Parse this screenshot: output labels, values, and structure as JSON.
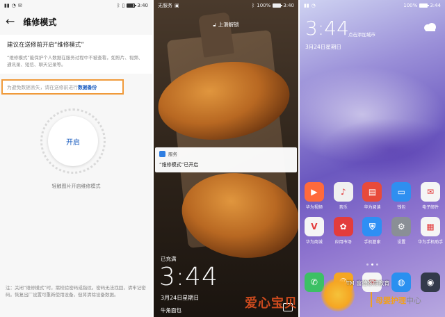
{
  "panel_settings": {
    "status": {
      "time": "3:40"
    },
    "title": "维修模式",
    "heading": "建议在送修前开启“维修模式”",
    "description": "“维修模式”能保护个人数据在服务过程中不被查看，如照片、视频、通讯录、短信、聊天记录等。",
    "warning_text": "为避免数据丢失，请在送修前进行",
    "warning_link": "数据备份",
    "enable_button": "开启",
    "hint": "轻触图片开启维修模式",
    "footer": "注：关闭“维修模式”时，需校验密码或指纹。密码无法找回，请牢记密码。恢复出厂设置可重新使用设备，但将清除设备数据。"
  },
  "panel_lock": {
    "status": {
      "carrier": "无服务",
      "battery": "100%",
      "time": "3:40"
    },
    "swipe_text": "上滑解锁",
    "notification": {
      "app": "服务",
      "body": "“维修模式”已开启"
    },
    "charged": "已充满",
    "time": "3:44",
    "date": "3月24日星期日",
    "caption": "牛角面包"
  },
  "panel_home": {
    "status": {
      "battery": "100%",
      "time": "3:44"
    },
    "time": "3:44",
    "city_hint": "点击添加城市",
    "date": "3月24日星期日",
    "rows": [
      [
        {
          "label": "华为视频",
          "color": "#ff6a3c",
          "glyph": "▶"
        },
        {
          "label": "音乐",
          "color": "#f0f0f0",
          "glyph": "♪"
        },
        {
          "label": "华为阅读",
          "color": "#e84a3a",
          "glyph": "▤"
        },
        {
          "label": "钱包",
          "color": "#2f8ff0",
          "glyph": "▭"
        },
        {
          "label": "电子邮件",
          "color": "#f5f5f5",
          "glyph": "✉"
        }
      ],
      [
        {
          "label": "华为商城",
          "color": "#f5f5f5",
          "glyph": "V"
        },
        {
          "label": "应用市场",
          "color": "#e33c3c",
          "glyph": "✿"
        },
        {
          "label": "手机管家",
          "color": "#2e8ff4",
          "glyph": "⛨"
        },
        {
          "label": "设置",
          "color": "#8a8f96",
          "glyph": "⚙"
        },
        {
          "label": "华为手机助手",
          "color": "#f5f5f5",
          "glyph": "▦"
        }
      ]
    ],
    "dock": [
      {
        "label": "电话",
        "color": "#3cc065",
        "glyph": "✆"
      },
      {
        "label": "联系人",
        "color": "#f5a623",
        "glyph": "☺"
      },
      {
        "label": "信息",
        "color": "#f5f5f5",
        "glyph": "✉"
      },
      {
        "label": "浏览器",
        "color": "#2a90f0",
        "glyph": "◍"
      },
      {
        "label": "相机",
        "color": "#333a4a",
        "glyph": "◉"
      }
    ]
  },
  "watermark": {
    "left": "爱心宝贝",
    "tm": "TM 富德家庭教育",
    "right_main": "母婴护理",
    "right_small": "中心"
  }
}
